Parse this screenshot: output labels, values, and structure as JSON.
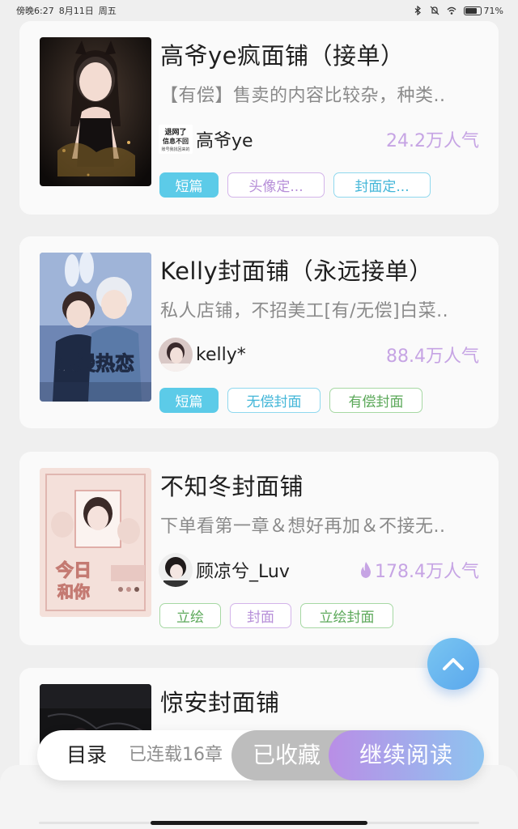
{
  "status_bar": {
    "time": "傍晚6:27",
    "date": "8月11日",
    "weekday": "周五",
    "battery": "71%",
    "battery_level": 0.71,
    "icons": [
      "bluetooth-icon",
      "mute-icon",
      "wifi-icon",
      "battery-icon"
    ]
  },
  "shops": [
    {
      "title": "高爷ye疯面铺（接单）",
      "description": "【有偿】售卖的内容比较杂，种类..",
      "author": "高爷ye",
      "popularity": "24.2万人气",
      "tags": [
        "短篇",
        "头像定...",
        "封面定..."
      ],
      "avatar_text": [
        "退网了",
        "信息不回",
        "账号我找回来的"
      ]
    },
    {
      "title": "Kelly封面铺（永远接单）",
      "description": "私人店铺，不招美工[有/无偿]白菜..",
      "author": "kelly*",
      "popularity": "88.4万人气",
      "tags": [
        "短篇",
        "无偿封面",
        "有偿封面"
      ]
    },
    {
      "title": "不知冬封面铺",
      "description": "下单看第一章＆想好再加＆不接无..",
      "author": "顾凉兮_Luv",
      "popularity": "178.4万人气",
      "hot": true,
      "tags": [
        "立绘",
        "封面",
        "立绘封面"
      ]
    },
    {
      "title": "惊安封面铺"
    }
  ],
  "reading_bar": {
    "toc_label": "目录",
    "serial_status": "已连载16章",
    "collected_label": "已收藏",
    "continue_label": "继续阅读"
  },
  "colors": {
    "accent_cyan": "#5ccbe8",
    "popularity_purple": "#c6a4e4",
    "continue_gradient_start": "#b98ee6",
    "continue_gradient_end": "#8ec4f0",
    "background": "#efefef"
  }
}
